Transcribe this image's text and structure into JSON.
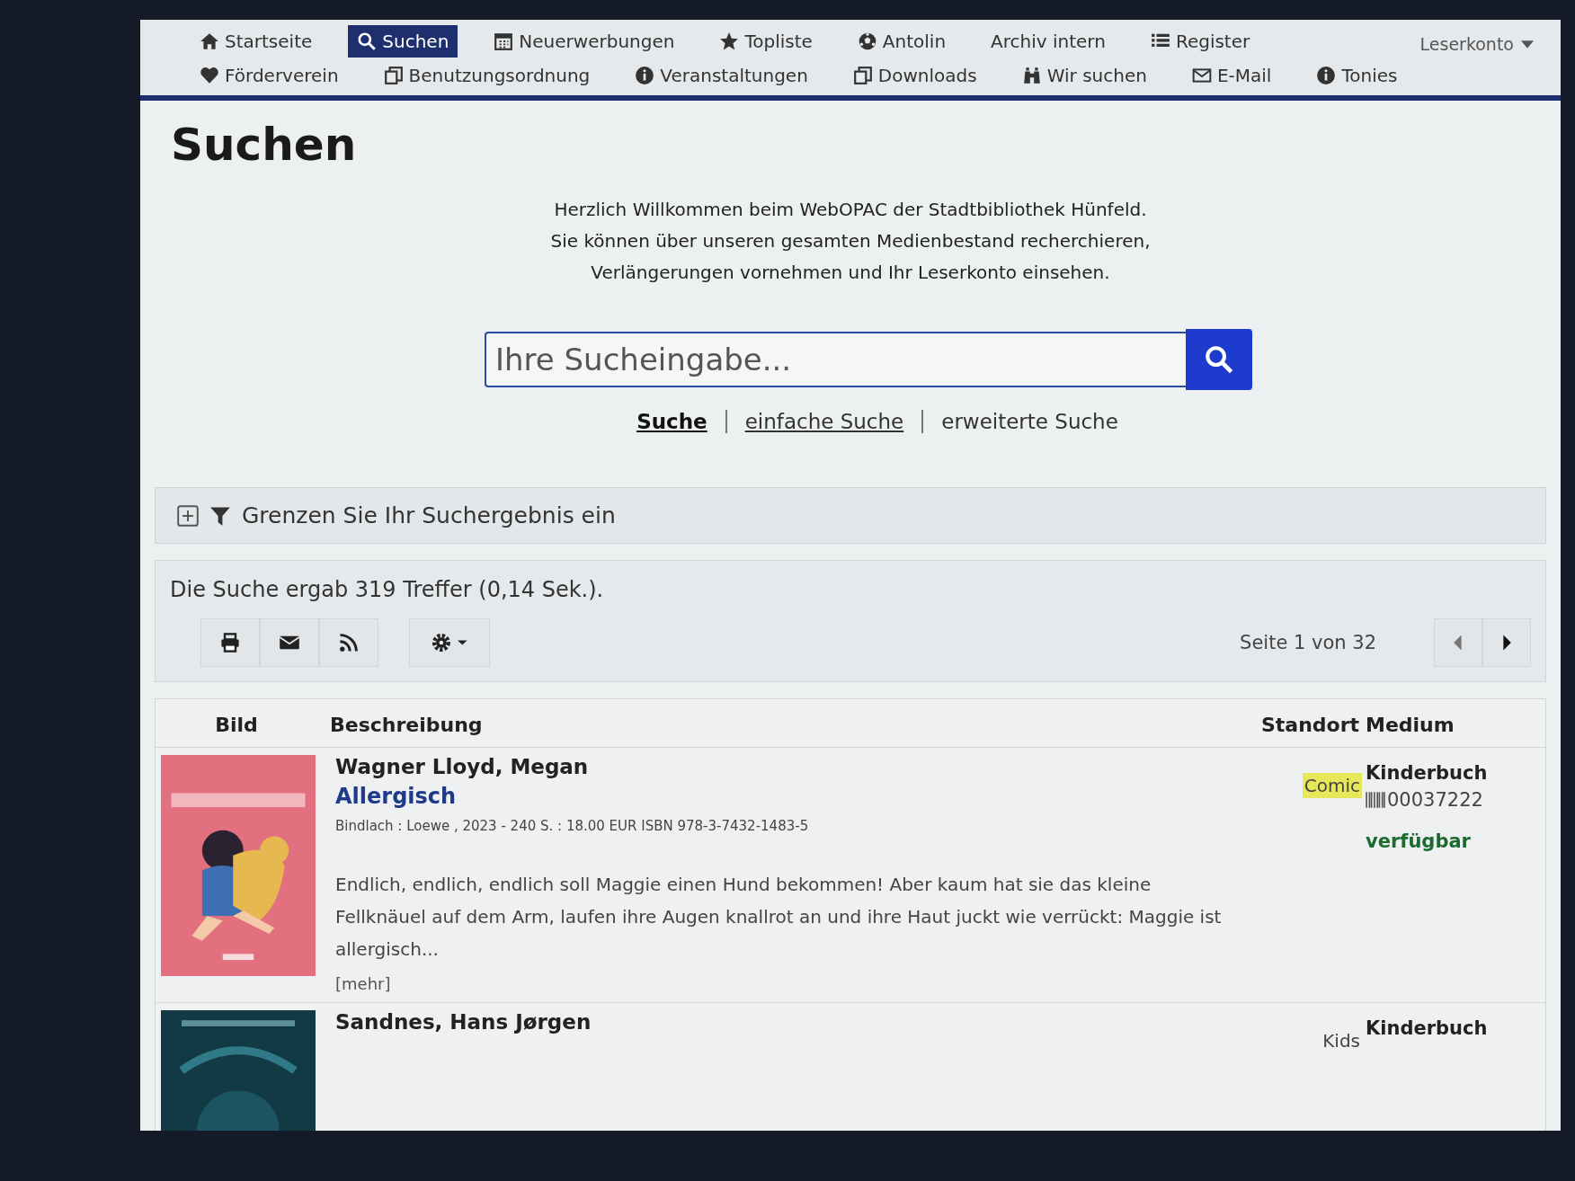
{
  "nav": {
    "items": [
      {
        "label": "Startseite",
        "selected": false
      },
      {
        "label": "Suchen",
        "selected": true
      },
      {
        "label": "Neuerwerbungen",
        "selected": false
      },
      {
        "label": "Topliste",
        "selected": false
      },
      {
        "label": "Antolin",
        "selected": false
      },
      {
        "label": "Archiv intern",
        "selected": false
      },
      {
        "label": "Register",
        "selected": false
      },
      {
        "label": "Förderverein",
        "selected": false
      },
      {
        "label": "Benutzungsordnung",
        "selected": false
      },
      {
        "label": "Veranstaltungen",
        "selected": false
      },
      {
        "label": "Downloads",
        "selected": false
      },
      {
        "label": "Wir suchen",
        "selected": false
      },
      {
        "label": "E-Mail",
        "selected": false
      },
      {
        "label": "Tonies",
        "selected": false
      }
    ],
    "account": "Leserkonto"
  },
  "heading": "Suchen",
  "welcome": [
    "Herzlich Willkommen beim WebOPAC der Stadtbibliothek Hünfeld.",
    "Sie können über unseren gesamten Medienbestand recherchieren,",
    "Verlängerungen vornehmen und Ihr Leserkonto einsehen."
  ],
  "search": {
    "placeholder": "Ihre Sucheingabe..."
  },
  "search_modes": [
    {
      "label": "Suche",
      "selected": true,
      "kind": "link"
    },
    {
      "label": "einfache Suche",
      "selected": false,
      "kind": "link"
    },
    {
      "label": "erweiterte Suche",
      "selected": false,
      "kind": "plain"
    }
  ],
  "filter": {
    "label": "Grenzen Sie Ihr Suchergebnis ein",
    "expanded": false
  },
  "result_summary": "Die Suche ergab 319 Treffer (0,14 Sek.).",
  "page_info": "Seite 1 von 32",
  "table": {
    "columns": [
      "Bild",
      "Beschreibung",
      "Standort",
      "Medium"
    ],
    "rows": [
      {
        "author": "Wagner Lloyd, Megan",
        "title": "Allergisch",
        "details": "Bindlach : Loewe , 2023 - 240 S. : 18.00 EUR ISBN 978-3-7432-1483-5",
        "abstract": "Endlich, endlich, endlich soll Maggie einen Hund bekommen! Aber kaum hat sie das kleine Fellknäuel auf dem Arm, laufen ihre Augen knallrot an und ihre Haut juckt wie verrückt: Maggie ist allergisch...",
        "more": "[mehr]",
        "location": "Comic",
        "location_highlight": true,
        "medium": "Kinderbuch",
        "barcode": "00037222",
        "status": "verfügbar"
      },
      {
        "author": "Sandnes, Hans Jørgen",
        "location": "Kids",
        "location_highlight": false,
        "medium": "Kinderbuch"
      }
    ]
  }
}
